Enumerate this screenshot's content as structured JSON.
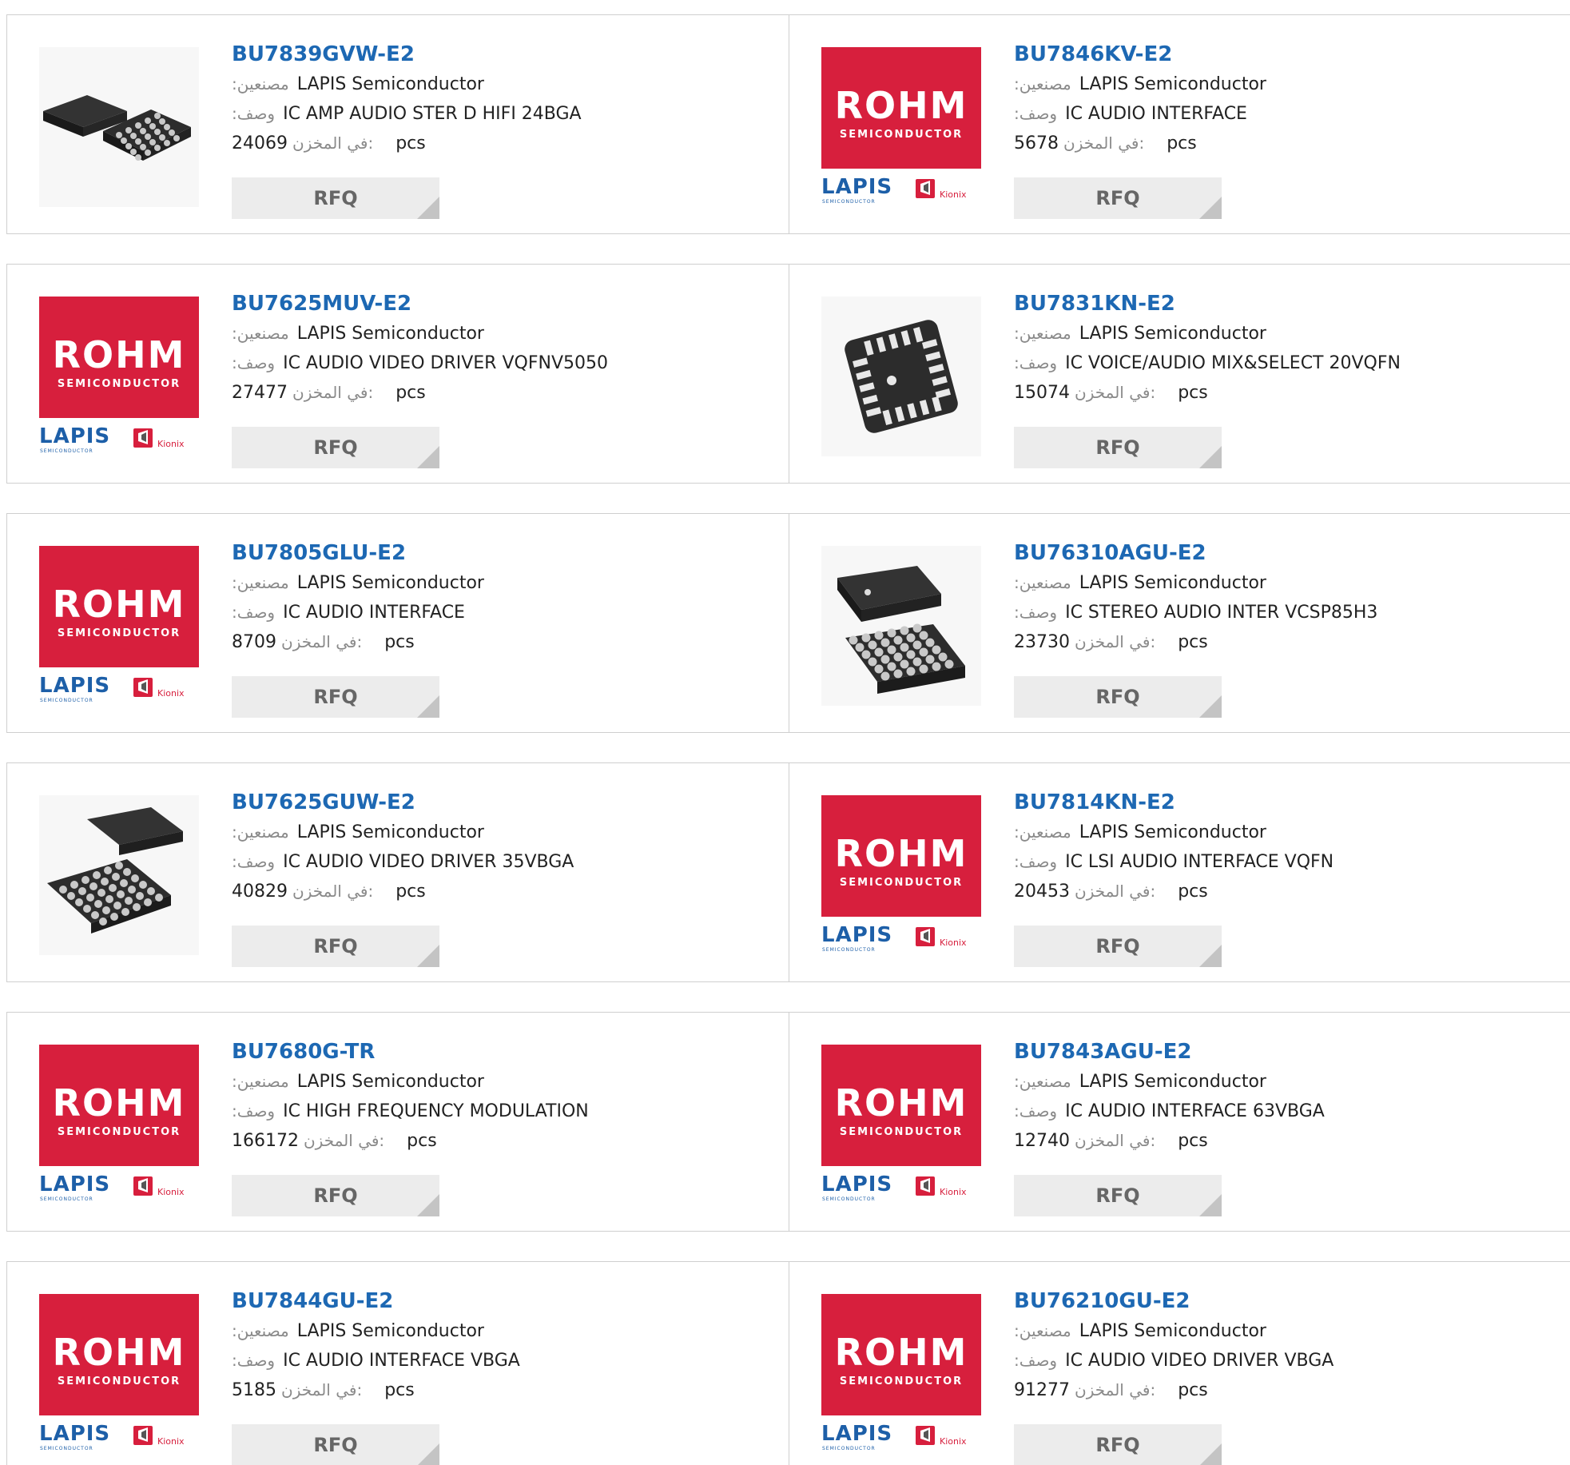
{
  "labels": {
    "manufacturer": ":مصنعين",
    "description": ":وصف",
    "stock": "في المخزن:",
    "pcs": "pcs",
    "rfq": "RFQ"
  },
  "colors": {
    "part_link": "#1d68b3",
    "rohm_red": "#d71f3d",
    "lapis_blue": "#1d5fa8",
    "rfq_bg": "#ececec"
  },
  "logo_text": {
    "rohm": "ROHM",
    "semiconductor": "SEMICONDUCTOR",
    "lapis": "LAPIS",
    "lapis_sub": "SEMICONDUCTOR",
    "kionix": "Kionix"
  },
  "products": [
    {
      "part": "BU7839GVW-E2",
      "manufacturer": "LAPIS Semiconductor",
      "description": "IC AMP AUDIO STER D HIFI 24BGA",
      "stock": "24069",
      "image": "chip-bga-pair"
    },
    {
      "part": "BU7846KV-E2",
      "manufacturer": "LAPIS Semiconductor",
      "description": "IC AUDIO INTERFACE",
      "stock": "5678",
      "image": "rohm-logo"
    },
    {
      "part": "BU7625MUV-E2",
      "manufacturer": "LAPIS Semiconductor",
      "description": "IC AUDIO VIDEO DRIVER VQFNV5050",
      "stock": "27477",
      "image": "rohm-logo"
    },
    {
      "part": "BU7831KN-E2",
      "manufacturer": "LAPIS Semiconductor",
      "description": "IC VOICE/AUDIO MIX&SELECT 20VQFN",
      "stock": "15074",
      "image": "chip-qfn"
    },
    {
      "part": "BU7805GLU-E2",
      "manufacturer": "LAPIS Semiconductor",
      "description": "IC AUDIO INTERFACE",
      "stock": "8709",
      "image": "rohm-logo"
    },
    {
      "part": "BU76310AGU-E2",
      "manufacturer": "LAPIS Semiconductor",
      "description": "IC STEREO AUDIO INTER VCSP85H3",
      "stock": "23730",
      "image": "chip-bga-stack"
    },
    {
      "part": "BU7625GUW-E2",
      "manufacturer": "LAPIS Semiconductor",
      "description": "IC AUDIO VIDEO DRIVER 35VBGA",
      "stock": "40829",
      "image": "chip-bga-pair2"
    },
    {
      "part": "BU7814KN-E2",
      "manufacturer": "LAPIS Semiconductor",
      "description": "IC LSI AUDIO INTERFACE VQFN",
      "stock": "20453",
      "image": "rohm-logo"
    },
    {
      "part": "BU7680G-TR",
      "manufacturer": "LAPIS Semiconductor",
      "description": "IC HIGH FREQUENCY MODULATION",
      "stock": "166172",
      "image": "rohm-logo"
    },
    {
      "part": "BU7843AGU-E2",
      "manufacturer": "LAPIS Semiconductor",
      "description": "IC AUDIO INTERFACE 63VBGA",
      "stock": "12740",
      "image": "rohm-logo"
    },
    {
      "part": "BU7844GU-E2",
      "manufacturer": "LAPIS Semiconductor",
      "description": "IC AUDIO INTERFACE VBGA",
      "stock": "5185",
      "image": "rohm-logo"
    },
    {
      "part": "BU76210GU-E2",
      "manufacturer": "LAPIS Semiconductor",
      "description": "IC AUDIO VIDEO DRIVER VBGA",
      "stock": "91277",
      "image": "rohm-logo"
    }
  ]
}
